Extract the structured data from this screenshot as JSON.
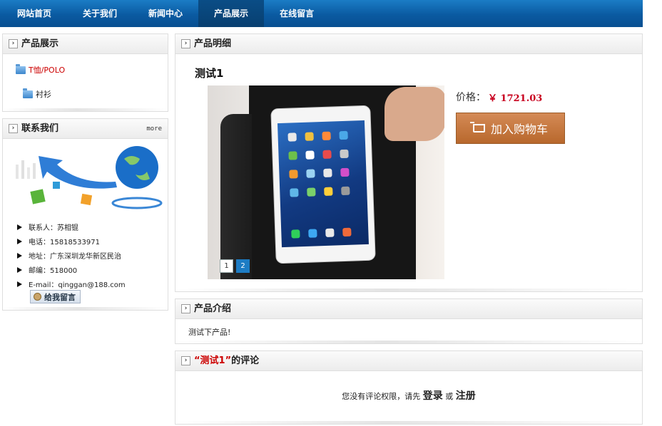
{
  "nav": {
    "items": [
      "网站首页",
      "关于我们",
      "新闻中心",
      "产品展示",
      "在线留言"
    ],
    "active_index": 3
  },
  "left_products": {
    "title": "产品展示",
    "categories": [
      "T恤/POLO",
      "衬衫"
    ]
  },
  "contact": {
    "title": "联系我们",
    "more": "more",
    "lines": [
      "联系人：苏相锟",
      "电话：15818533971",
      "地址：广东深圳龙华新区民治",
      "邮编：518000",
      "E-mail：qinggan@188.com"
    ],
    "message_button": "给我留言"
  },
  "detail": {
    "title": "产品明细",
    "product_name": "测试1",
    "price_label": "价格：",
    "price_value": "￥ 1721.03",
    "add_to_cart": "加入购物车",
    "pages": [
      "1",
      "2"
    ],
    "active_page": 2
  },
  "intro": {
    "title": "产品介绍",
    "text": "测试下产品!"
  },
  "comments": {
    "quote_open": "“测试1”",
    "title_suffix": "的评论",
    "msg_prefix": "您没有评论权限，请先",
    "login": "登录",
    "or": "或",
    "register": "注册"
  },
  "colors": {
    "nav_blue": "#0a5aa1",
    "price_red": "#c8001e",
    "cart_button": "#c37a40"
  }
}
